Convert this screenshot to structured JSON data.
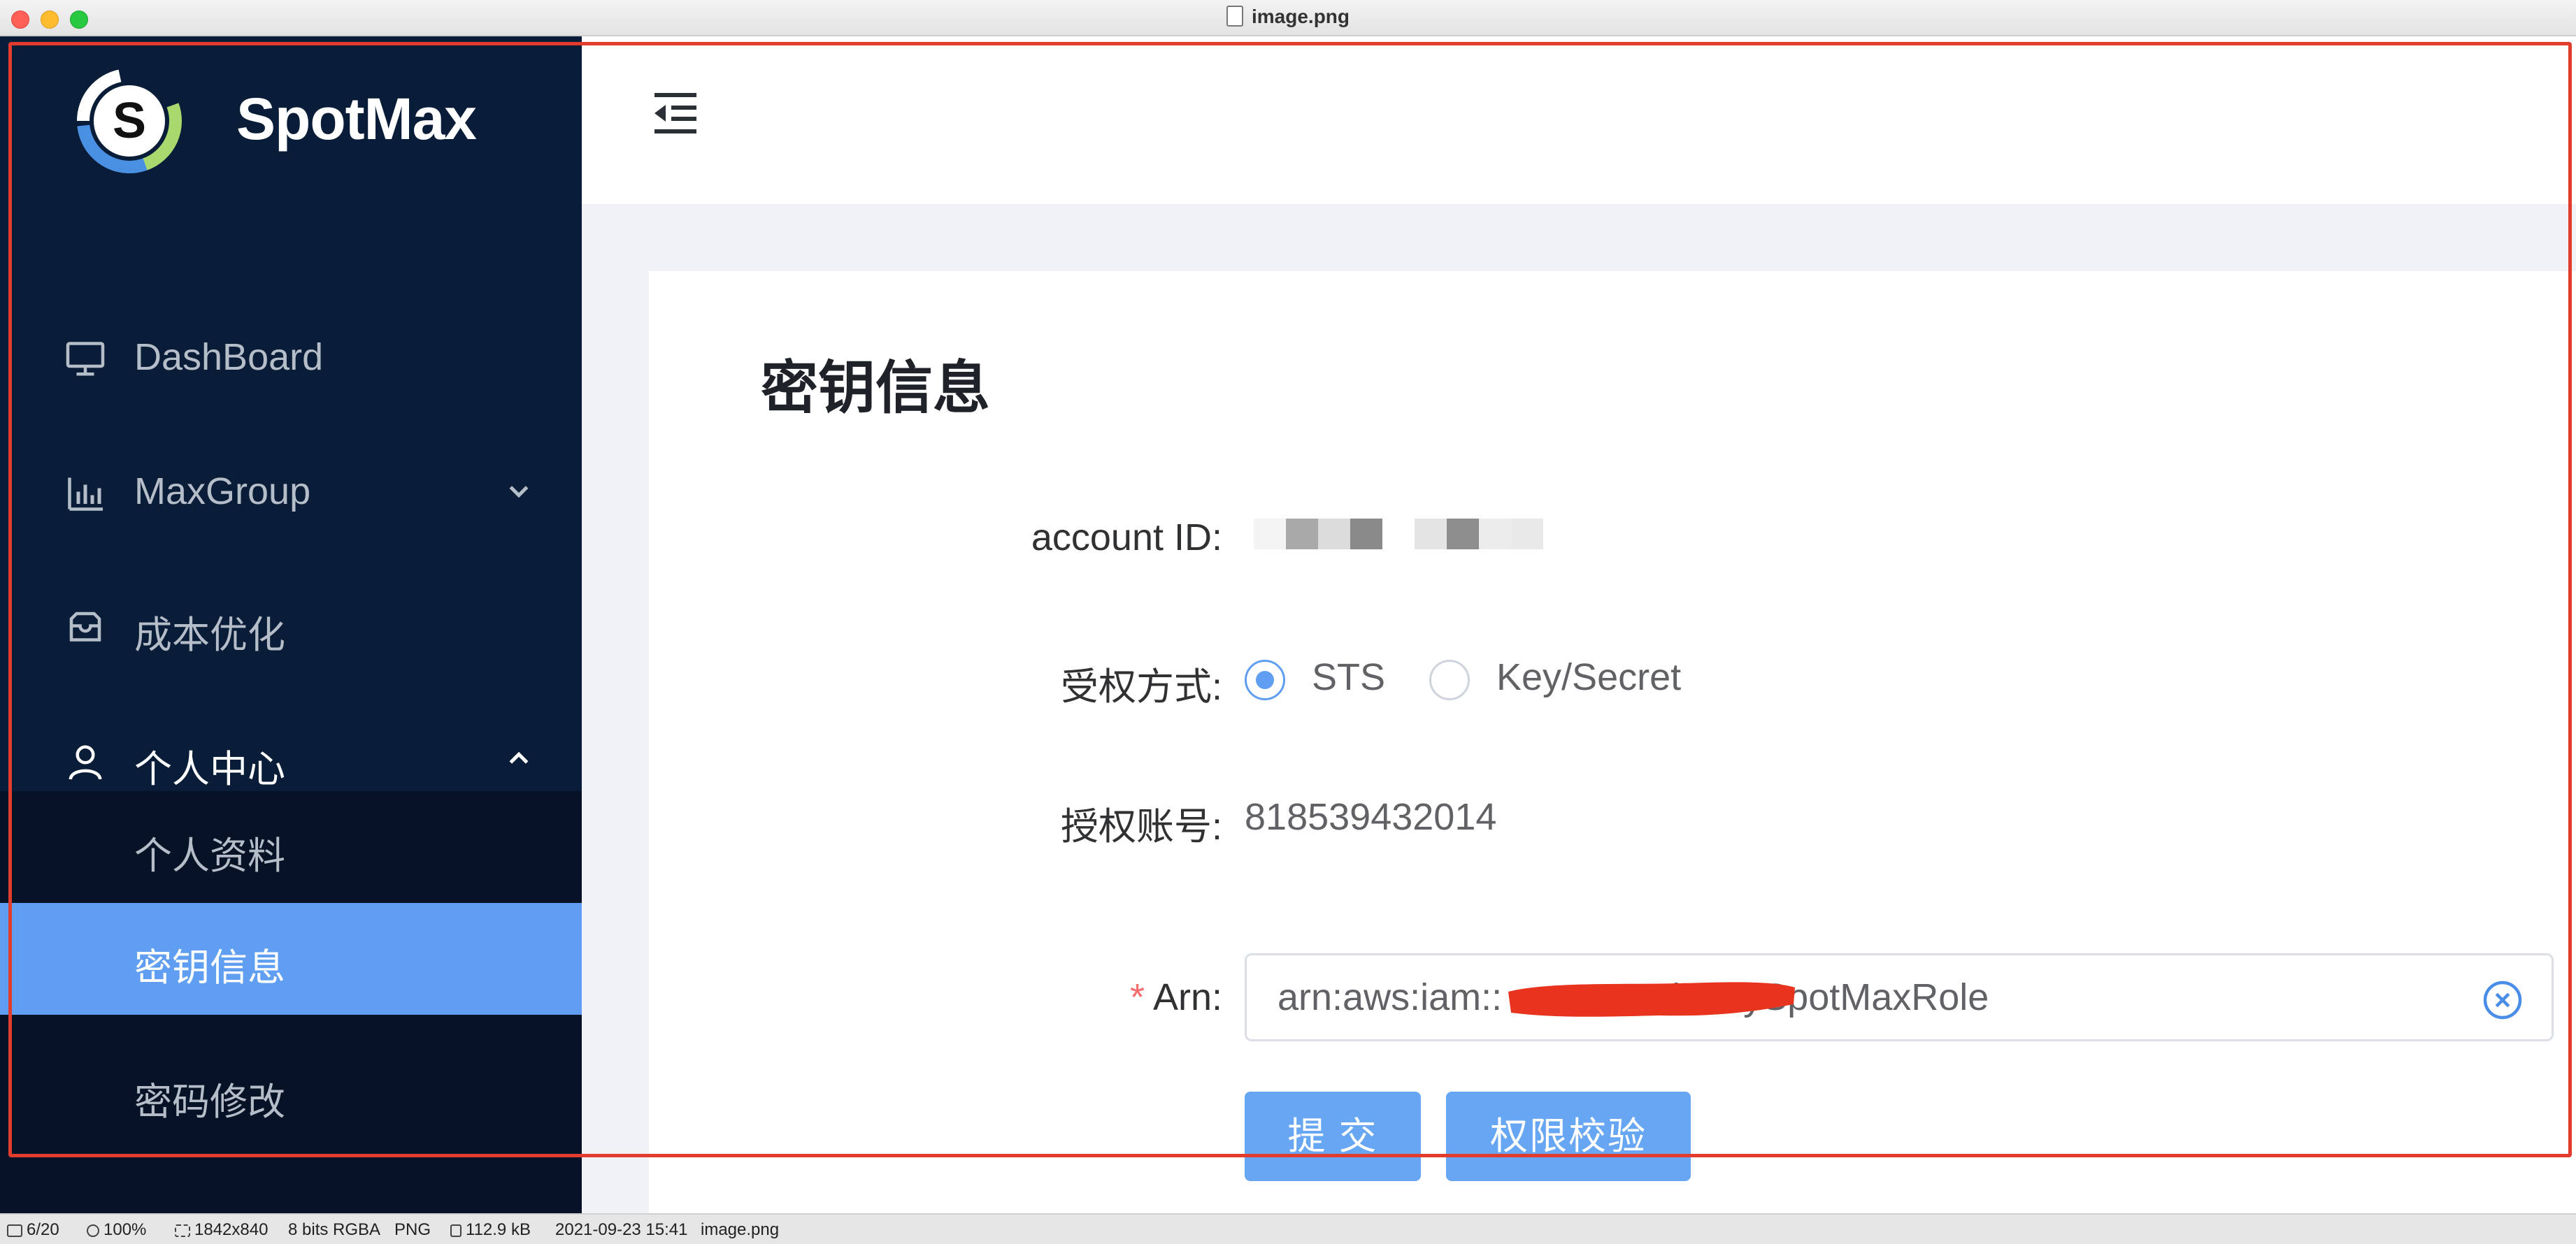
{
  "window": {
    "title": "image.png"
  },
  "app": {
    "brand": "SpotMax"
  },
  "sidebar": {
    "items": [
      {
        "label": "DashBoard",
        "icon": "monitor-icon"
      },
      {
        "label": "MaxGroup",
        "icon": "bar-chart-icon",
        "chevron": "chevron-down-icon"
      },
      {
        "label": "成本优化",
        "icon": "inbox-icon"
      },
      {
        "label": "个人中心",
        "icon": "user-icon",
        "chevron": "chevron-up-icon"
      }
    ],
    "subitems": [
      {
        "label": "个人资料",
        "active": false
      },
      {
        "label": "密钥信息",
        "active": true
      },
      {
        "label": "密码修改",
        "active": false
      }
    ]
  },
  "header": {
    "fold_icon": "menu-fold-icon"
  },
  "main": {
    "title": "密钥信息",
    "form": {
      "account_id_label": "account ID:",
      "auth_method_label": "受权方式:",
      "auth_options": [
        "STS",
        "Key/Secret"
      ],
      "auth_selected": "STS",
      "auth_account_label": "授权账号:",
      "auth_account_value": "818539432014",
      "arn_required_mark": "*",
      "arn_label": "Arn:",
      "arn_value": "arn:aws:iam::            :role/mySpotMaxRole"
    },
    "buttons": {
      "submit": "提 交",
      "verify": "权限校验"
    }
  },
  "statusbar": {
    "page": "6/20",
    "zoom": "100%",
    "dimensions": "1842x840",
    "color_depth": "8 bits RGBA",
    "format": "PNG",
    "file_size": "112.9 kB",
    "date": "2021-09-23 15:41",
    "filename": "image.png"
  },
  "colors": {
    "sidebar_bg": "#0a1d38",
    "submenu_bg": "#061327",
    "accent": "#5f9ef0",
    "button": "#66a6f2",
    "annotation": "#e23c2f",
    "required": "#f56c6c"
  }
}
